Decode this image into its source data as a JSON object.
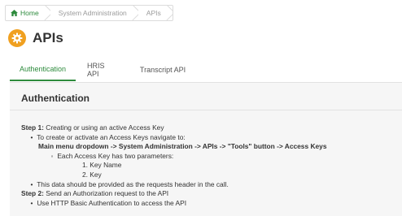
{
  "breadcrumb": {
    "home": "Home",
    "system_admin": "System Administration",
    "apis": "APIs"
  },
  "header": {
    "title": "APIs",
    "icon": "gear-icon",
    "icon_color": "#f0a020"
  },
  "tabs": [
    {
      "label": "Authentication",
      "active": true
    },
    {
      "label": "HRIS API",
      "active": false
    },
    {
      "label": "Transcript API",
      "active": false
    }
  ],
  "accent_color": "#2e8b3d",
  "content": {
    "title": "Authentication",
    "step1_label": "Step 1:",
    "step1_text": " Creating or using an active Access Key",
    "step1_sub1": "To create or activate an Access Keys navigate to:",
    "step1_path": "Main menu dropdown -> System Administration -> APIs -> \"Tools\" button -> Access Keys",
    "step1_params": "Each Access Key has two parameters:",
    "param1": "1. Key Name",
    "param2": "2. Key",
    "step1_note": "This data should be provided as the requests header in the call.",
    "step2_label": "Step 2:",
    "step2_text": " Send an Authorization request to the API",
    "step2_sub1": "Use HTTP Basic Authentication to access the API"
  }
}
